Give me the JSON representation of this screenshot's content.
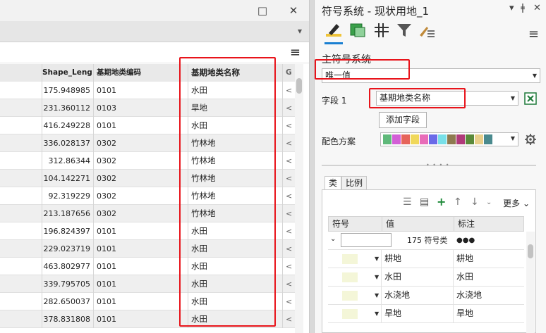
{
  "window": {
    "restore_glyph": "□",
    "close_glyph": "✕"
  },
  "table": {
    "headers": [
      "",
      "Shape_Leng",
      "基期地类编码",
      "基期地类名称",
      "G"
    ],
    "rows": [
      {
        "length": "175.948985",
        "code": "0101",
        "name": "水田"
      },
      {
        "length": "231.360112",
        "code": "0103",
        "name": "旱地"
      },
      {
        "length": "416.249228",
        "code": "0101",
        "name": "水田"
      },
      {
        "length": "336.028137",
        "code": "0302",
        "name": "竹林地"
      },
      {
        "length": "312.86344",
        "code": "0302",
        "name": "竹林地"
      },
      {
        "length": "104.142271",
        "code": "0302",
        "name": "竹林地"
      },
      {
        "length": "92.319229",
        "code": "0302",
        "name": "竹林地"
      },
      {
        "length": "213.187656",
        "code": "0302",
        "name": "竹林地"
      },
      {
        "length": "196.824397",
        "code": "0101",
        "name": "水田"
      },
      {
        "length": "229.023719",
        "code": "0101",
        "name": "水田"
      },
      {
        "length": "463.802977",
        "code": "0101",
        "name": "水田"
      },
      {
        "length": "339.795705",
        "code": "0101",
        "name": "水田"
      },
      {
        "length": "282.650037",
        "code": "0101",
        "name": "水田"
      },
      {
        "length": "378.831808",
        "code": "0101",
        "name": "水田"
      }
    ],
    "trailing_glyph": "<"
  },
  "symbology": {
    "title": "符号系统 - 现状用地_1",
    "ctrl_glyphs": [
      "▾",
      "ǂ",
      "✕"
    ],
    "primary_label": "主符号系统",
    "primary_value": "唯一值",
    "field_label": "字段 1",
    "field_value": "基期地类名称",
    "add_field_label": "添加字段",
    "color_scheme_label": "配色方案",
    "ramp_colors": [
      "#5fb97a",
      "#d35fd6",
      "#e6645a",
      "#f0d85a",
      "#e86cb8",
      "#6a6ae8",
      "#78e0e8",
      "#8e7a50",
      "#b03a7a",
      "#5a8a3a",
      "#e8cf8a",
      "#4a8a8e"
    ],
    "tabs": [
      "类",
      "比例"
    ],
    "more_label": "更多",
    "grid_headers": [
      "符号",
      "值",
      "标注"
    ],
    "count_label": "175 符号类",
    "dots": "●●●",
    "classes": [
      {
        "value": "耕地",
        "label": "耕地"
      },
      {
        "value": "水田",
        "label": "水田"
      },
      {
        "value": "水浇地",
        "label": "水浇地"
      },
      {
        "value": "旱地",
        "label": "旱地"
      }
    ]
  },
  "icons": {
    "pane_icons": [
      "pencil-edit-icon",
      "fill-polygon-icon",
      "vary-symbology-icon",
      "filter-icon",
      "label-brush-icon"
    ],
    "tools": [
      "list-icon",
      "add-from-list-icon",
      "plus-icon",
      "arrow-up-icon",
      "arrow-down-icon",
      "sort-icon"
    ],
    "field_action": "excel-icon",
    "settings": "gear-icon"
  },
  "colors": {
    "highlight": "#e8141b",
    "accent": "#1a7fd1",
    "symbol_fill": "#f4f6d8"
  }
}
